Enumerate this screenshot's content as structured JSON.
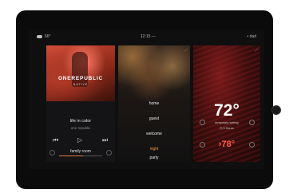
{
  "status": {
    "weather_icon": "cloud-icon",
    "temperature": "66°",
    "time": "12:15 —",
    "user": "• dad"
  },
  "music": {
    "album_band": "ONEREPUBLIC",
    "album_subtitle": "NATIVE",
    "track_title": "life in color",
    "artist": "one republic",
    "controls": {
      "prev": "⏮",
      "play": "▷",
      "next": "⏭"
    },
    "room": "family room",
    "volume_level": 0.55
  },
  "scenes": {
    "items": [
      "home",
      "guest",
      "welcome",
      "night",
      "party"
    ],
    "active": "night"
  },
  "thermostat": {
    "current": "72°",
    "label": "temporary setting",
    "duration": "◷ 3 Hours",
    "target": "›78°",
    "accent": "#ff5a4a"
  },
  "colors": {
    "accent_orange": "#f39a45",
    "accent_red": "#ff5a4a"
  }
}
